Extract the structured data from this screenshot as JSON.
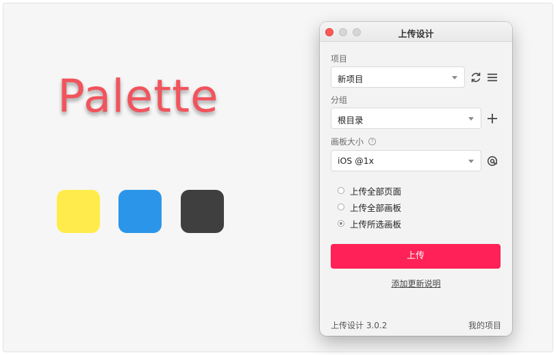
{
  "canvas": {
    "title": "Palette",
    "title_color": "#f1545d",
    "swatches": [
      {
        "name": "yellow",
        "color": "#ffec4c"
      },
      {
        "name": "blue",
        "color": "#2b96e9"
      },
      {
        "name": "dark",
        "color": "#3f3f3f"
      }
    ]
  },
  "window": {
    "title": "上传设计",
    "controls": [
      "close",
      "minimize",
      "maximize"
    ]
  },
  "project": {
    "label": "项目",
    "selected": "新项目",
    "icons": [
      "refresh-icon",
      "menu-icon"
    ]
  },
  "group": {
    "label": "分组",
    "selected": "根目录",
    "icons": [
      "plus-icon"
    ]
  },
  "artboard_size": {
    "label": "画板大小",
    "help_glyph": "?",
    "selected": "iOS @1x",
    "icons": [
      "at-icon"
    ]
  },
  "upload_scope": {
    "options": [
      {
        "label": "上传全部页面",
        "checked": false
      },
      {
        "label": "上传全部画板",
        "checked": false
      },
      {
        "label": "上传所选画板",
        "checked": true
      }
    ]
  },
  "actions": {
    "upload_label": "上传",
    "upload_color": "#ff2157",
    "changelog_label": "添加更新说明"
  },
  "footer": {
    "version": "上传设计 3.0.2",
    "my_projects": "我的项目"
  }
}
